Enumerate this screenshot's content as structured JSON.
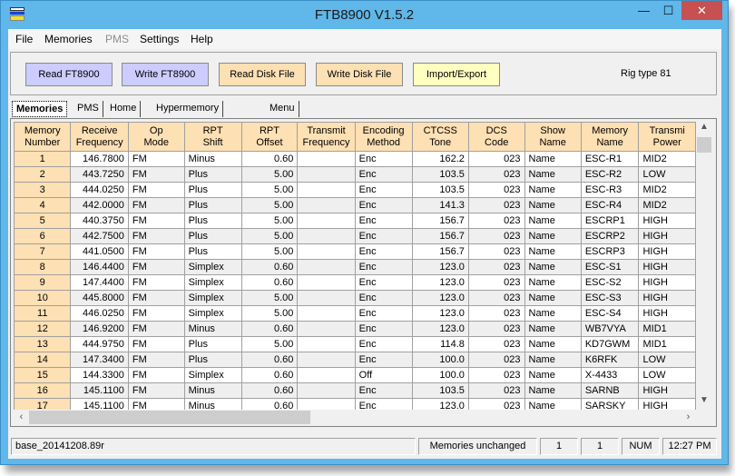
{
  "window": {
    "title": "FTB8900 V1.5.2",
    "minimize_glyph": "—",
    "maximize_glyph": "☐",
    "close_glyph": "✕"
  },
  "menu": [
    "File",
    "Memories",
    "PMS",
    "Settings",
    "Help"
  ],
  "toolbar": {
    "read_radio": "Read FT8900",
    "write_radio": "Write FT8900",
    "read_disk": "Read Disk File",
    "write_disk": "Write Disk File",
    "import_export": "Import/Export",
    "rig_type": "Rig type 81"
  },
  "tabs": [
    "Memories",
    "PMS",
    "Home",
    "Hypermemory VFOs",
    "Menu items"
  ],
  "grid": {
    "headers": [
      [
        "Memory",
        "Number"
      ],
      [
        "Receive",
        "Frequency"
      ],
      [
        "Op",
        "Mode"
      ],
      [
        "RPT",
        "Shift"
      ],
      [
        "RPT",
        "Offset"
      ],
      [
        "Transmit",
        "Frequency"
      ],
      [
        "Encoding",
        "Method"
      ],
      [
        "CTCSS",
        "Tone"
      ],
      [
        "DCS",
        "Code"
      ],
      [
        "Show",
        "Name"
      ],
      [
        "Memory",
        "Name"
      ],
      [
        "Transmi",
        "Power"
      ]
    ],
    "rows": [
      [
        "1",
        "146.7800",
        "FM",
        "Minus",
        "0.60",
        "",
        "Enc",
        "162.2",
        "023",
        "Name",
        "ESC-R1",
        "MID2"
      ],
      [
        "2",
        "443.7250",
        "FM",
        "Plus",
        "5.00",
        "",
        "Enc",
        "103.5",
        "023",
        "Name",
        "ESC-R2",
        "LOW"
      ],
      [
        "3",
        "444.0250",
        "FM",
        "Plus",
        "5.00",
        "",
        "Enc",
        "103.5",
        "023",
        "Name",
        "ESC-R3",
        "MID2"
      ],
      [
        "4",
        "442.0000",
        "FM",
        "Plus",
        "5.00",
        "",
        "Enc",
        "141.3",
        "023",
        "Name",
        "ESC-R4",
        "MID2"
      ],
      [
        "5",
        "440.3750",
        "FM",
        "Plus",
        "5.00",
        "",
        "Enc",
        "156.7",
        "023",
        "Name",
        "ESCRP1",
        "HIGH"
      ],
      [
        "6",
        "442.7500",
        "FM",
        "Plus",
        "5.00",
        "",
        "Enc",
        "156.7",
        "023",
        "Name",
        "ESCRP2",
        "HIGH"
      ],
      [
        "7",
        "441.0500",
        "FM",
        "Plus",
        "5.00",
        "",
        "Enc",
        "156.7",
        "023",
        "Name",
        "ESCRP3",
        "HIGH"
      ],
      [
        "8",
        "146.4400",
        "FM",
        "Simplex",
        "0.60",
        "",
        "Enc",
        "123.0",
        "023",
        "Name",
        "ESC-S1",
        "HIGH"
      ],
      [
        "9",
        "147.4400",
        "FM",
        "Simplex",
        "0.60",
        "",
        "Enc",
        "123.0",
        "023",
        "Name",
        "ESC-S2",
        "HIGH"
      ],
      [
        "10",
        "445.8000",
        "FM",
        "Simplex",
        "5.00",
        "",
        "Enc",
        "123.0",
        "023",
        "Name",
        "ESC-S3",
        "HIGH"
      ],
      [
        "11",
        "446.0250",
        "FM",
        "Simplex",
        "5.00",
        "",
        "Enc",
        "123.0",
        "023",
        "Name",
        "ESC-S4",
        "HIGH"
      ],
      [
        "12",
        "146.9200",
        "FM",
        "Minus",
        "0.60",
        "",
        "Enc",
        "123.0",
        "023",
        "Name",
        "WB7VYA",
        "MID1"
      ],
      [
        "13",
        "444.9750",
        "FM",
        "Plus",
        "5.00",
        "",
        "Enc",
        "114.8",
        "023",
        "Name",
        "KD7GWM",
        "MID1"
      ],
      [
        "14",
        "147.3400",
        "FM",
        "Plus",
        "0.60",
        "",
        "Enc",
        "100.0",
        "023",
        "Name",
        "K6RFK",
        "LOW"
      ],
      [
        "15",
        "144.3300",
        "FM",
        "Simplex",
        "0.60",
        "",
        "Off",
        "100.0",
        "023",
        "Name",
        "X-4433",
        "LOW"
      ],
      [
        "16",
        "145.1100",
        "FM",
        "Minus",
        "0.60",
        "",
        "Enc",
        "103.5",
        "023",
        "Name",
        "SARNB",
        "HIGH"
      ],
      [
        "17",
        "145.1100",
        "FM",
        "Minus",
        "0.60",
        "",
        "Enc",
        "123.0",
        "023",
        "Name",
        "SARSKY",
        "HIGH"
      ]
    ]
  },
  "status": {
    "file": "base_20141208.89r",
    "memories": "Memories unchanged",
    "field1": "1",
    "field2": "1",
    "num": "NUM",
    "time": "12:27 PM"
  }
}
